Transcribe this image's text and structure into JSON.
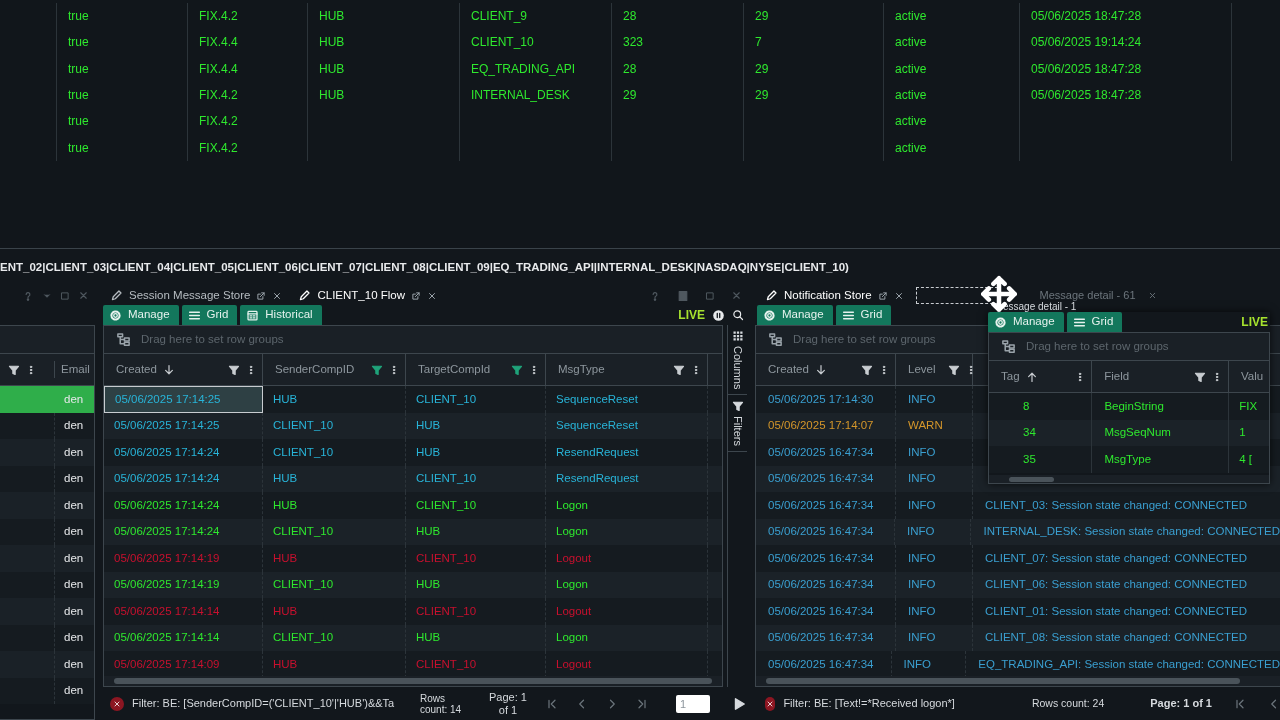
{
  "sessions_table": {
    "rows": [
      {
        "cells": [
          "true",
          "FIX.4.2",
          "HUB",
          "CLIENT_9",
          "28",
          "29",
          "active",
          "05/06/2025 18:47:28"
        ]
      },
      {
        "cells": [
          "true",
          "FIX.4.4",
          "HUB",
          "CLIENT_10",
          "323",
          "7",
          "active",
          "05/06/2025 19:14:24"
        ]
      },
      {
        "cells": [
          "true",
          "FIX.4.4",
          "HUB",
          "EQ_TRADING_API",
          "28",
          "29",
          "active",
          "05/06/2025 18:47:28"
        ]
      },
      {
        "cells": [
          "true",
          "FIX.4.2",
          "HUB",
          "INTERNAL_DESK",
          "29",
          "29",
          "active",
          "05/06/2025 18:47:28"
        ]
      },
      {
        "cells": [
          "true",
          "FIX.4.2",
          null,
          null,
          null,
          null,
          "active",
          null
        ]
      },
      {
        "cells": [
          "true",
          "FIX.4.2",
          null,
          null,
          null,
          null,
          "active",
          null
        ]
      }
    ]
  },
  "session_list": "ENT_02|CLIENT_03|CLIENT_04|CLIENT_05|CLIENT_06|CLIENT_07|CLIENT_08|CLIENT_09|EQ_TRADING_API|INTERNAL_DESK|NASDAQ|NYSE|CLIENT_10)",
  "left_panel": {
    "column_header": "Email",
    "rows": [
      {
        "text": "den",
        "selected": true
      },
      {
        "text": "den",
        "selected": false
      },
      {
        "text": "den",
        "selected": false
      },
      {
        "text": "den",
        "selected": false
      },
      {
        "text": "den",
        "selected": false
      },
      {
        "text": "den",
        "selected": false
      },
      {
        "text": "den",
        "selected": false
      },
      {
        "text": "den",
        "selected": false
      },
      {
        "text": "den",
        "selected": false
      },
      {
        "text": "den",
        "selected": false
      },
      {
        "text": "den",
        "selected": false
      },
      {
        "text": "den",
        "selected": false
      }
    ]
  },
  "flow_panel": {
    "tabs": [
      {
        "label": "Session Message Store",
        "selected": false
      },
      {
        "label": "CLIENT_10 Flow",
        "selected": true
      }
    ],
    "toolbar": [
      {
        "kind": "manage",
        "label": "Manage"
      },
      {
        "kind": "grid",
        "label": "Grid"
      },
      {
        "kind": "historical",
        "label": "Historical"
      }
    ],
    "live": "LIVE",
    "group_hint": "Drag here to set row groups",
    "columns": [
      {
        "label": "Created",
        "sort_descending": true,
        "filtered": false
      },
      {
        "label": "SenderCompID",
        "filtered": true
      },
      {
        "label": "TargetCompId",
        "filtered": true
      },
      {
        "label": "MsgType",
        "filtered": false
      }
    ],
    "side_tabs": [
      {
        "kind": "columns",
        "label": "Columns"
      },
      {
        "kind": "filters",
        "label": "Filters"
      }
    ],
    "rows": [
      {
        "kind": "admin",
        "selected": true,
        "cells": [
          "05/06/2025 17:14:25",
          "HUB",
          "CLIENT_10",
          "SequenceReset"
        ]
      },
      {
        "kind": "admin",
        "selected": false,
        "cells": [
          "05/06/2025 17:14:25",
          "CLIENT_10",
          "HUB",
          "SequenceReset"
        ]
      },
      {
        "kind": "admin",
        "selected": false,
        "cells": [
          "05/06/2025 17:14:24",
          "CLIENT_10",
          "HUB",
          "ResendRequest"
        ]
      },
      {
        "kind": "admin",
        "selected": false,
        "cells": [
          "05/06/2025 17:14:24",
          "HUB",
          "CLIENT_10",
          "ResendRequest"
        ]
      },
      {
        "kind": "logon",
        "selected": false,
        "cells": [
          "05/06/2025 17:14:24",
          "HUB",
          "CLIENT_10",
          "Logon"
        ]
      },
      {
        "kind": "logon",
        "selected": false,
        "cells": [
          "05/06/2025 17:14:24",
          "CLIENT_10",
          "HUB",
          "Logon"
        ]
      },
      {
        "kind": "logout",
        "selected": false,
        "cells": [
          "05/06/2025 17:14:19",
          "HUB",
          "CLIENT_10",
          "Logout"
        ]
      },
      {
        "kind": "logon",
        "selected": false,
        "cells": [
          "05/06/2025 17:14:19",
          "CLIENT_10",
          "HUB",
          "Logon"
        ]
      },
      {
        "kind": "logout",
        "selected": false,
        "cells": [
          "05/06/2025 17:14:14",
          "HUB",
          "CLIENT_10",
          "Logout"
        ]
      },
      {
        "kind": "logon",
        "selected": false,
        "cells": [
          "05/06/2025 17:14:14",
          "CLIENT_10",
          "HUB",
          "Logon"
        ]
      },
      {
        "kind": "logout",
        "selected": false,
        "cells": [
          "05/06/2025 17:14:09",
          "HUB",
          "CLIENT_10",
          "Logout"
        ]
      }
    ],
    "footer": {
      "filter": "Filter: BE: [SenderCompID=('CLIENT_10'|'HUB')&&Ta",
      "rows_count": "Rows count: 14",
      "page": "Page: 1 of 1",
      "page_input": "1"
    }
  },
  "notification_panel": {
    "tab": "Notification Store",
    "other_tab": "Message detail - 61",
    "drag_label": "essage detail - 1",
    "toolbar": [
      {
        "kind": "manage",
        "label": "Manage"
      },
      {
        "kind": "grid",
        "label": "Grid"
      }
    ],
    "group_hint": "Drag here to set row groups",
    "columns": [
      {
        "label": "Created",
        "sort_descending": true
      },
      {
        "label": "Level"
      }
    ],
    "rows": [
      {
        "kind": "info",
        "created": "05/06/2025 17:14:30",
        "level": "INFO"
      },
      {
        "kind": "warn",
        "created": "05/06/2025 17:14:07",
        "level": "WARN"
      },
      {
        "kind": "info",
        "created": "05/06/2025 16:47:34",
        "level": "INFO"
      },
      {
        "kind": "info",
        "created": "05/06/2025 16:47:34",
        "level": "INFO"
      },
      {
        "kind": "info",
        "created": "05/06/2025 16:47:34",
        "level": "INFO",
        "text": "CLIENT_03: Session state changed: CONNECTED"
      },
      {
        "kind": "info",
        "created": "05/06/2025 16:47:34",
        "level": "INFO",
        "text": "INTERNAL_DESK: Session state changed: CONNECTED"
      },
      {
        "kind": "info",
        "created": "05/06/2025 16:47:34",
        "level": "INFO",
        "text": "CLIENT_07: Session state changed: CONNECTED"
      },
      {
        "kind": "info",
        "created": "05/06/2025 16:47:34",
        "level": "INFO",
        "text": "CLIENT_06: Session state changed: CONNECTED"
      },
      {
        "kind": "info",
        "created": "05/06/2025 16:47:34",
        "level": "INFO",
        "text": "CLIENT_01: Session state changed: CONNECTED"
      },
      {
        "kind": "info",
        "created": "05/06/2025 16:47:34",
        "level": "INFO",
        "text": "CLIENT_08: Session state changed: CONNECTED"
      },
      {
        "kind": "info",
        "created": "05/06/2025 16:47:34",
        "level": "INFO",
        "text": "EQ_TRADING_API: Session state changed: CONNECTED"
      }
    ],
    "footer": {
      "filter": "Filter: BE: [Text!=*Received logon*]",
      "rows_count": "Rows count: 24",
      "page": "Page: 1 of 1"
    },
    "message_detail": {
      "toolbar": [
        {
          "kind": "manage",
          "label": "Manage"
        },
        {
          "kind": "grid",
          "label": "Grid"
        }
      ],
      "live": "LIVE",
      "group_hint": "Drag here to set row groups",
      "columns": [
        {
          "label": "Tag",
          "sort_ascending": true
        },
        {
          "label": "Field"
        },
        {
          "label": "Valu"
        }
      ],
      "rows": [
        {
          "tag": "8",
          "field": "BeginString",
          "value": "FIX"
        },
        {
          "tag": "34",
          "field": "MsgSeqNum",
          "value": "1"
        },
        {
          "tag": "35",
          "field": "MsgType",
          "value": "4 ["
        }
      ]
    }
  }
}
